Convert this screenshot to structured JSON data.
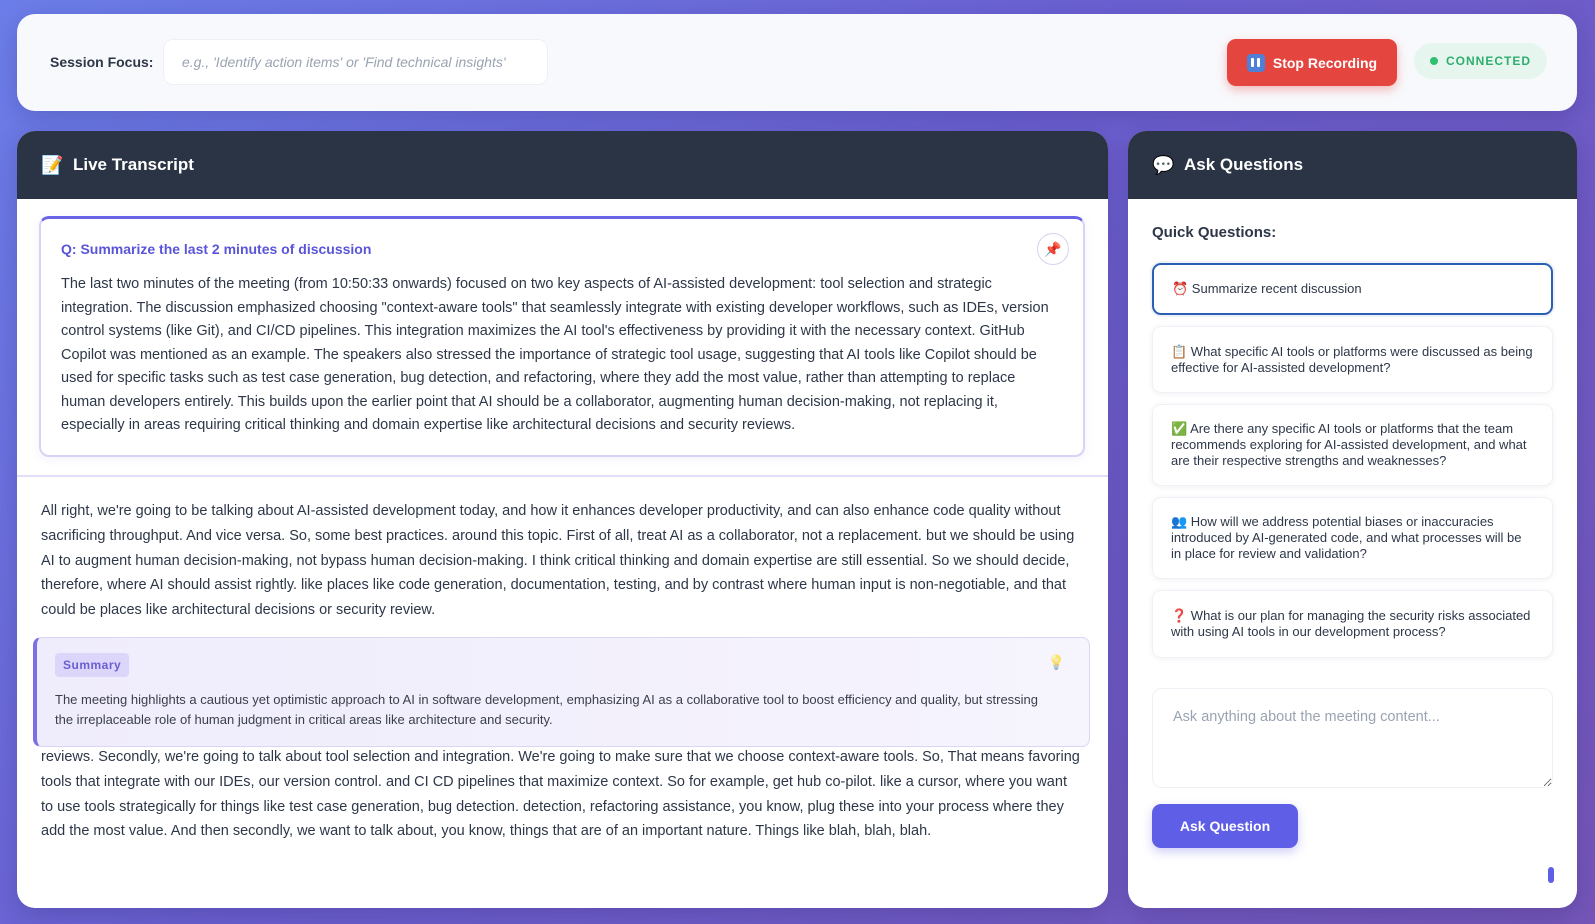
{
  "colors": {
    "accent": "#5f5ee6",
    "danger": "#e5453f",
    "success": "#2fae6f",
    "header_bg": "#2b3444",
    "background_gradient": [
      "#6b7de8",
      "#7456b8"
    ]
  },
  "topbar": {
    "focus_label": "Session Focus:",
    "focus_placeholder": "e.g., 'Identify action items' or 'Find technical insights'",
    "focus_value": "",
    "stop_icon": "pause-icon",
    "stop_label": "Stop Recording",
    "status": "CONNECTED"
  },
  "transcript_panel": {
    "icon": "memo-icon",
    "title": "Live Transcript",
    "qa": {
      "question": "Q: Summarize the last 2 minutes of discussion",
      "pin_icon": "pushpin-icon",
      "answer": "The last two minutes of the meeting (from 10:50:33 onwards) focused on two key aspects of AI-assisted development: tool selection and strategic integration. The discussion emphasized choosing \"context-aware tools\" that seamlessly integrate with existing developer workflows, such as IDEs, version control systems (like Git), and CI/CD pipelines. This integration maximizes the AI tool's effectiveness by providing it with the necessary context. GitHub Copilot was mentioned as an example. The speakers also stressed the importance of strategic tool usage, suggesting that AI tools like Copilot should be used for specific tasks such as test case generation, bug detection, and refactoring, where they add the most value, rather than attempting to replace human developers entirely. This builds upon the earlier point that AI should be a collaborator, augmenting human decision-making, not replacing it, especially in areas requiring critical thinking and domain expertise like architectural decisions and security reviews."
    },
    "segments": [
      "All right, we're going to be talking about AI-assisted development today, and how it enhances developer productivity, and can also enhance code quality without sacrificing throughput. And vice versa. So, some best practices. around this topic. First of all, treat AI as a collaborator, not a replacement. but we should be using AI to augment human decision-making, not bypass human decision-making. I think critical thinking and domain expertise are still essential. So we should decide, therefore, where AI should assist rightly. like places like code generation, documentation, testing, and by contrast where human input is non-negotiable, and that could be places like architectural decisions or security review.",
      " reviews. Secondly, we're going to talk about tool selection and integration. We're going to make sure that we choose context-aware tools. So, That means favoring tools that integrate with our IDEs, our version control. and CI CD pipelines that maximize context. So for example, get hub co-pilot. like a cursor, where you want to use tools strategically for things like test case generation, bug detection. detection, refactoring assistance, you know, plug these into your process where they add the most value. And then secondly, we want to talk about, you know, things that are of an important nature. Things like blah, blah, blah."
    ],
    "summary": {
      "tag": "Summary",
      "icon": "lightbulb-icon",
      "text": "The meeting highlights a cautious yet optimistic approach to AI in software development, emphasizing AI as a collaborative tool to boost efficiency and quality, but stressing the irreplaceable role of human judgment in critical areas like architecture and security."
    }
  },
  "questions_panel": {
    "icon": "speech-bubble-icon",
    "title": "Ask Questions",
    "quick_label": "Quick Questions:",
    "quick_questions": [
      "⏰ Summarize recent discussion",
      "📋 What specific AI tools or platforms were discussed as being effective for AI-assisted development?",
      "✅ Are there any specific AI tools or platforms that the team recommends exploring for AI-assisted development, and what are their respective strengths and weaknesses?",
      "👥 How will we address potential biases or inaccuracies introduced by AI-generated code, and what processes will be in place for review and validation?",
      "❓ What is our plan for managing the security risks associated with using AI tools in our development process?"
    ],
    "ask_placeholder": "Ask anything about the meeting content...",
    "ask_button": "Ask Question"
  }
}
